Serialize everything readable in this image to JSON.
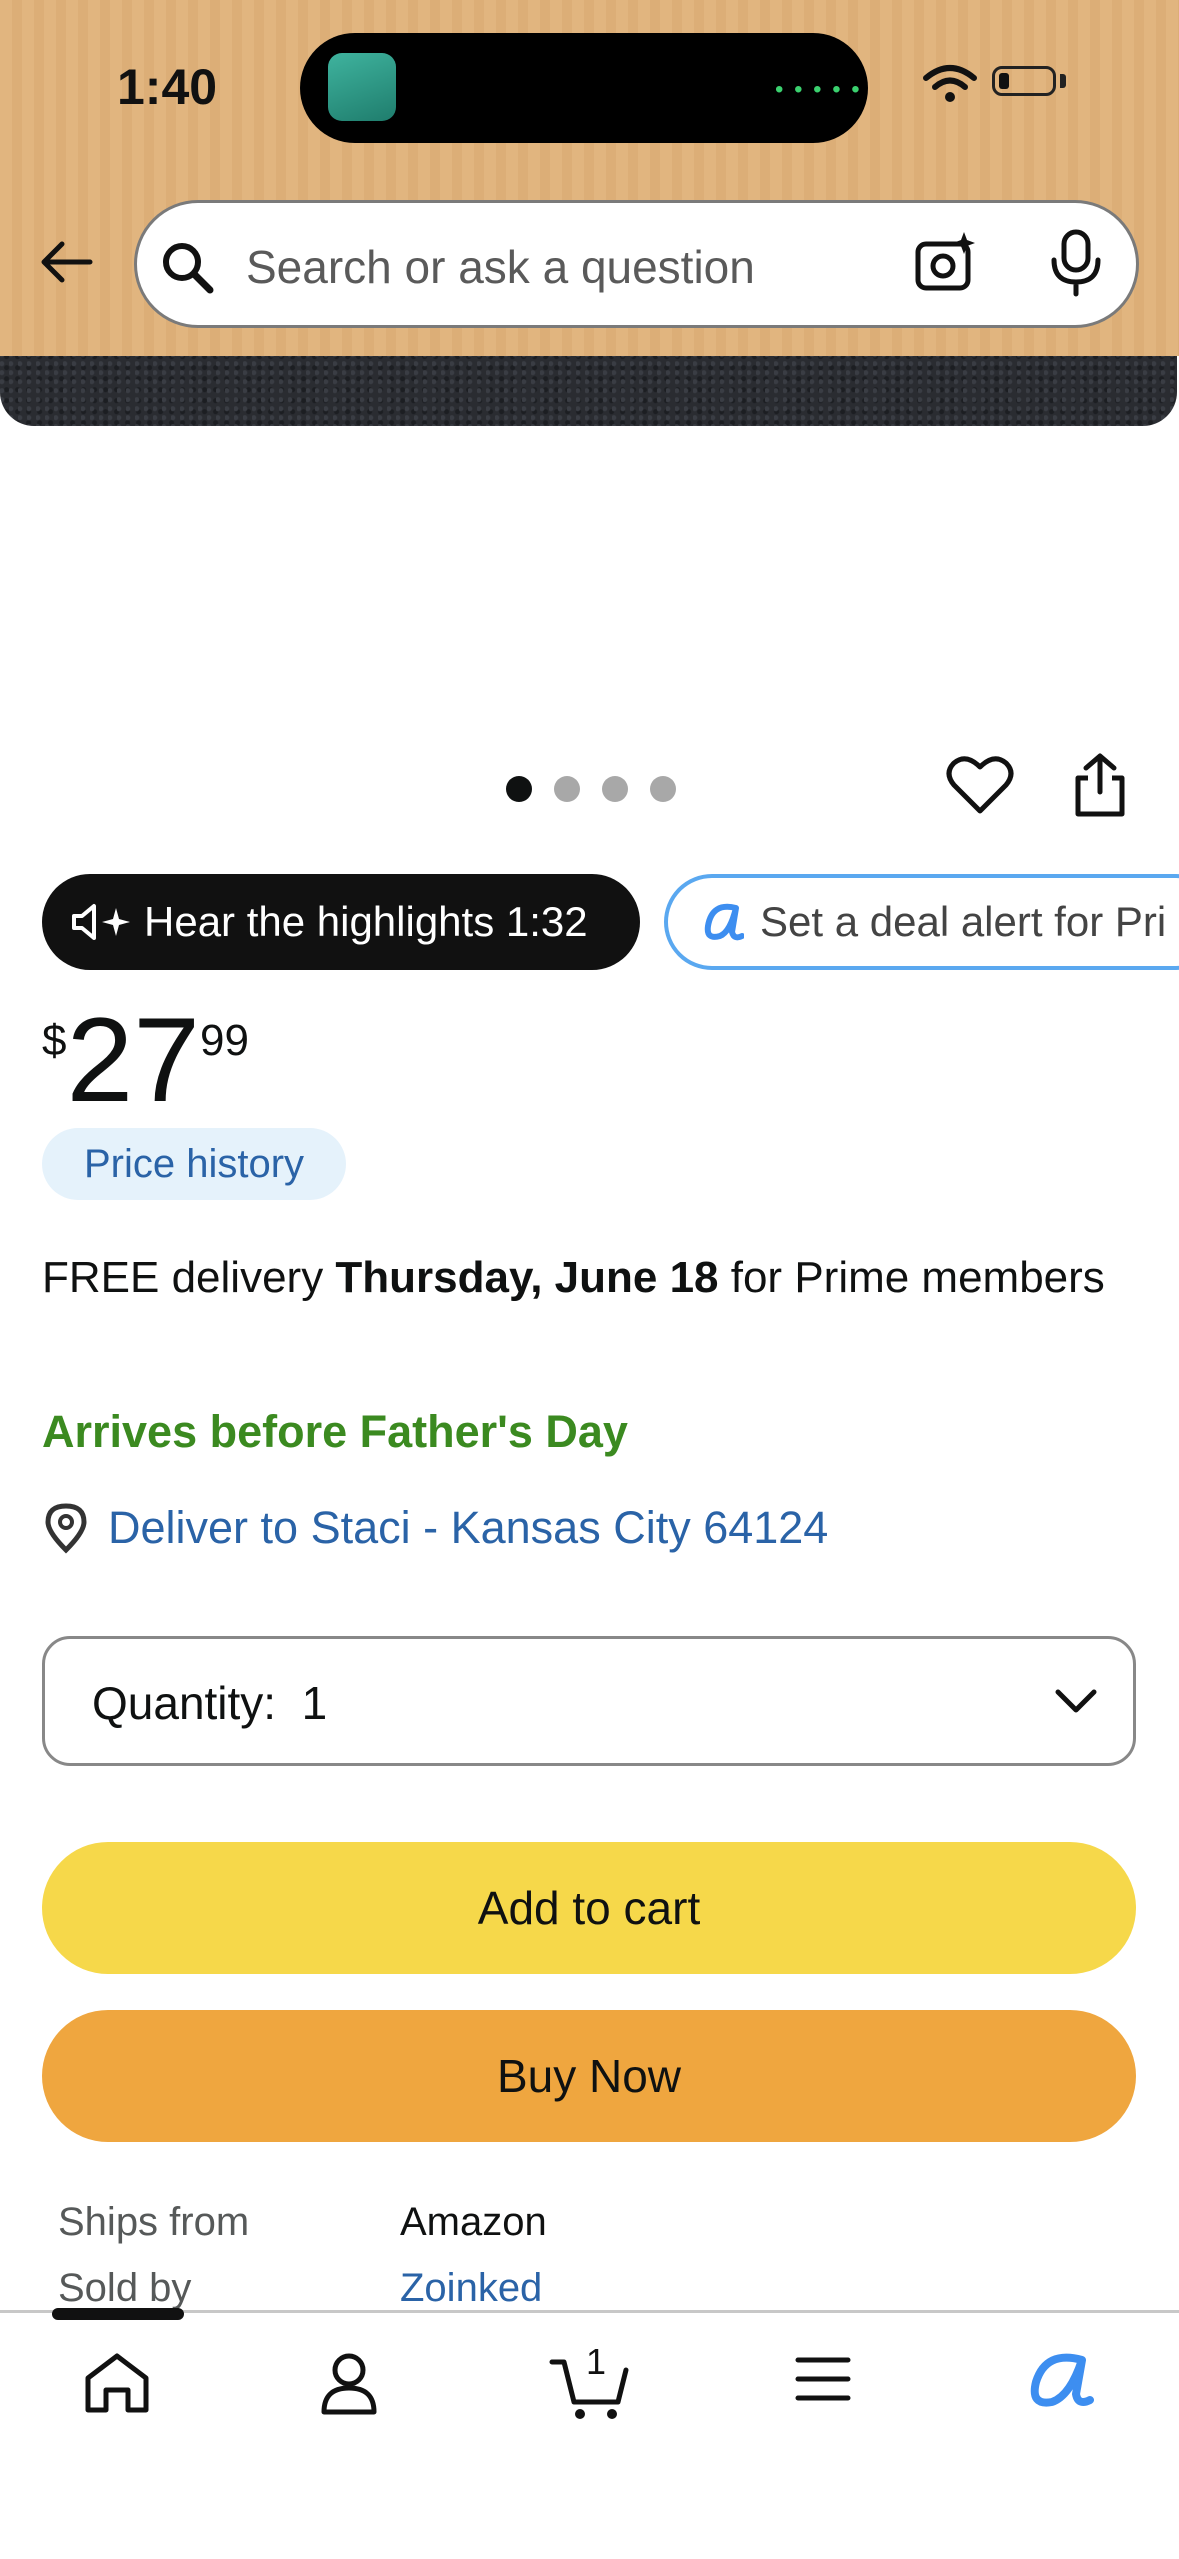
{
  "status_bar": {
    "time": "1:40"
  },
  "search": {
    "placeholder": "Search or ask a question"
  },
  "carousel": {
    "total": 4,
    "active": 1
  },
  "pills": {
    "hear": "Hear the highlights 1:32",
    "deal": "Set a deal alert for Pri"
  },
  "price": {
    "symbol": "$",
    "whole": "27",
    "fraction": "99"
  },
  "price_history_label": "Price history",
  "delivery": {
    "prefix": "FREE delivery ",
    "date": "Thursday, June 18",
    "suffix": " for Prime members",
    "note": "Arrives before Father's Day",
    "deliver_to": "Deliver to Staci - Kansas City 64124"
  },
  "quantity": {
    "label": "Quantity:",
    "value": "1"
  },
  "buttons": {
    "add_to_cart": "Add to cart",
    "buy_now": "Buy Now"
  },
  "seller_info": {
    "ships_from_label": "Ships from",
    "ships_from_value": "Amazon",
    "sold_by_label": "Sold by",
    "sold_by_value": "Zoinked"
  },
  "nav": {
    "cart_count": "1"
  },
  "colors": {
    "header": "#e1b57f",
    "add_to_cart": "#f6d84a",
    "buy_now": "#efa63f",
    "link": "#2a63a7",
    "green": "#3b8a20",
    "rufus_blue": "#3d8ef0"
  }
}
